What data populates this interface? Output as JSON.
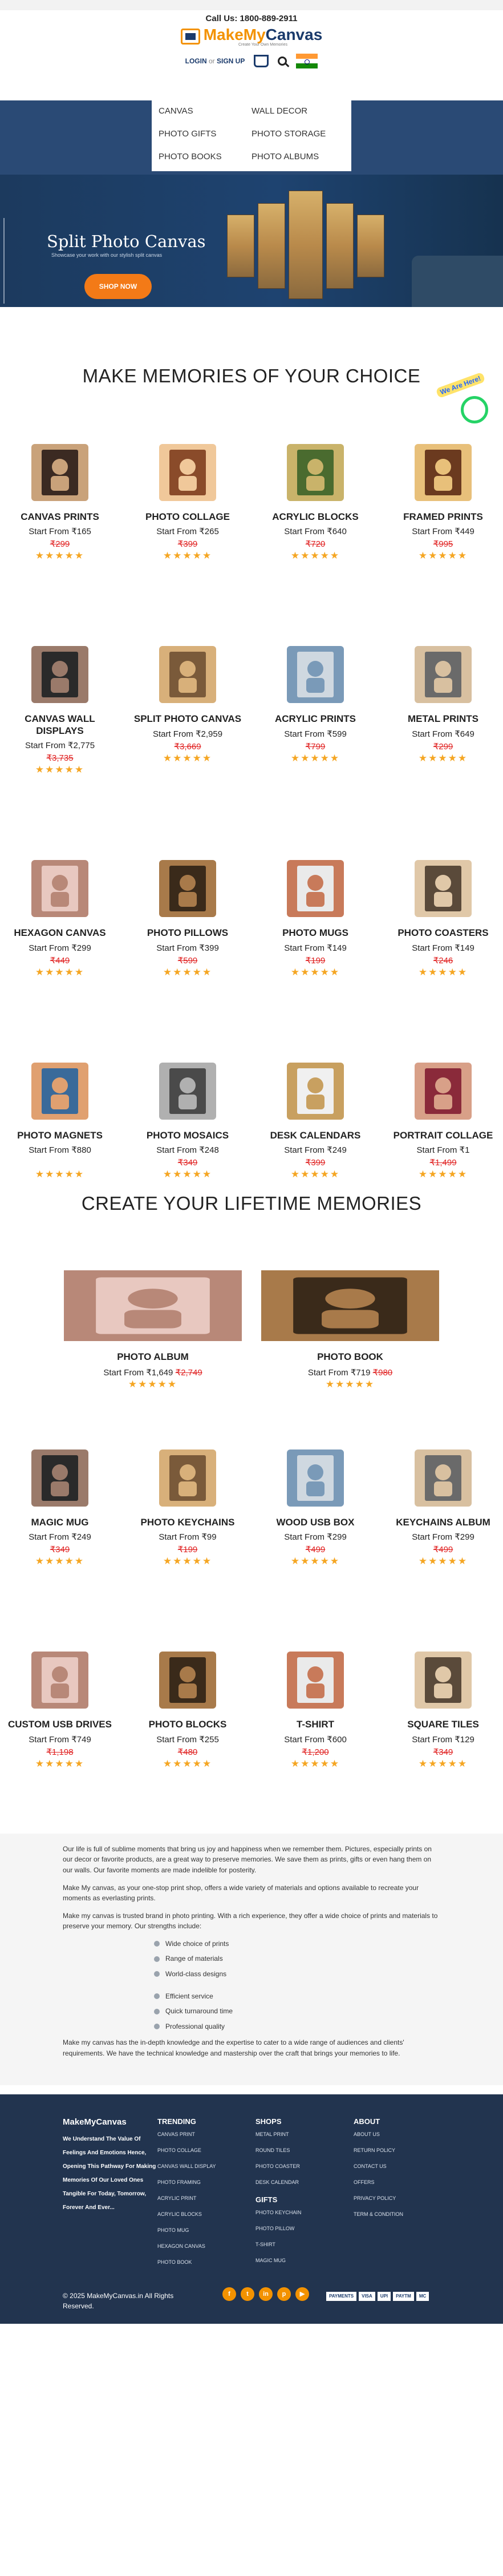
{
  "header": {
    "call_label": "Call Us:",
    "phone": "1800-889-2911",
    "logo_make": "MakeMy",
    "logo_canvas": "Canvas",
    "tagline": "Create Your Own Memories",
    "login": "LOGIN",
    "or": "or",
    "signup": "SIGN UP"
  },
  "nav": {
    "items": [
      "CANVAS",
      "WALL DECOR",
      "PHOTO GIFTS",
      "PHOTO STORAGE",
      "PHOTO BOOKS",
      "PHOTO ALBUMS"
    ]
  },
  "banner": {
    "title": "Split Photo Canvas",
    "subtitle": "Showcase your work with our stylish split canvas",
    "button": "SHOP NOW"
  },
  "chat_badge": "We Are Here!",
  "section1": {
    "title": "MAKE MEMORIES OF YOUR CHOICE",
    "products": [
      {
        "name": "CANVAS PRINTS",
        "price": "Start From ₹165",
        "old": "₹299"
      },
      {
        "name": "PHOTO COLLAGE",
        "price": "Start From ₹265",
        "old": "₹399"
      },
      {
        "name": "ACRYLIC BLOCKS",
        "price": "Start From ₹640",
        "old": "₹720"
      },
      {
        "name": "FRAMED PRINTS",
        "price": "Start From ₹449",
        "old": "₹995"
      },
      {
        "name": "CANVAS WALL DISPLAYS",
        "price": "Start From ₹2,775",
        "old": "₹3,735"
      },
      {
        "name": "SPLIT PHOTO CANVAS",
        "price": "Start From ₹2,959",
        "old": "₹3,669"
      },
      {
        "name": "ACRYLIC PRINTS",
        "price": "Start From ₹599",
        "old": "₹799"
      },
      {
        "name": "METAL PRINTS",
        "price": "Start From ₹649",
        "old": "₹299"
      },
      {
        "name": "HEXAGON CANVAS",
        "price": "Start From ₹299",
        "old": "₹449"
      },
      {
        "name": "PHOTO PILLOWS",
        "price": "Start From ₹399",
        "old": "₹599"
      },
      {
        "name": "PHOTO MUGS",
        "price": "Start From ₹149",
        "old": "₹199"
      },
      {
        "name": "PHOTO COASTERS",
        "price": "Start From ₹149",
        "old": "₹246"
      },
      {
        "name": "PHOTO MAGNETS",
        "price": "Start From ₹880",
        "old": ""
      },
      {
        "name": "PHOTO MOSAICS",
        "price": "Start From ₹248",
        "old": "₹349"
      },
      {
        "name": "DESK CALENDARS",
        "price": "Start From ₹249",
        "old": "₹399"
      },
      {
        "name": "PORTRAIT COLLAGE",
        "price": "Start From ₹1",
        "old": "₹1,499"
      }
    ]
  },
  "section2": {
    "title": "CREATE YOUR LIFETIME MEMORIES",
    "featured": [
      {
        "name": "PHOTO ALBUM",
        "price": "Start From ₹1,649",
        "old": "₹2,749"
      },
      {
        "name": "PHOTO BOOK",
        "price": "Start From ₹719",
        "old": "₹980"
      }
    ],
    "products": [
      {
        "name": "MAGIC MUG",
        "price": "Start From ₹249",
        "old": "₹349"
      },
      {
        "name": "PHOTO KEYCHAINS",
        "price": "Start From ₹99",
        "old": "₹199"
      },
      {
        "name": "WOOD USB BOX",
        "price": "Start From ₹299",
        "old": "₹499"
      },
      {
        "name": "KEYCHAINS ALBUM",
        "price": "Start From ₹299",
        "old": "₹499"
      },
      {
        "name": "CUSTOM USB DRIVES",
        "price": "Start From ₹749",
        "old": "₹1,198"
      },
      {
        "name": "PHOTO BLOCKS",
        "price": "Start From ₹255",
        "old": "₹480"
      },
      {
        "name": "T-SHIRT",
        "price": "Start From ₹600",
        "old": "₹1,200"
      },
      {
        "name": "SQUARE TILES",
        "price": "Start From ₹129",
        "old": "₹349"
      }
    ]
  },
  "stars": "★★★★★",
  "about": {
    "p1": "Our life is full of sublime moments that bring us joy and happiness when we remember them. Pictures, especially prints on our decor or favorite products, are a great way to preserve memories. We save them as prints, gifts or even hang them on our walls. Our favorite moments are made indelible for posterity.",
    "p2": "Make My canvas, as your one-stop print shop, offers a wide variety of materials and options available to recreate your moments as everlasting prints.",
    "p3": "Make my canvas is trusted brand in photo printing. With a rich experience, they offer a wide choice of prints and materials to preserve your memory. Our strengths include:",
    "list1": [
      "Wide choice of prints",
      "Range of materials",
      "World-class designs"
    ],
    "list2": [
      "Efficient service",
      "Quick turnaround time",
      "Professional quality"
    ],
    "p4": "Make my canvas has the in-depth knowledge and the expertise to cater to a wide range of audiences and clients' requirements. We have the technical knowledge and mastership over the craft that brings your memories to life."
  },
  "footer": {
    "logo": "MakeMyCanvas",
    "about_text": "We Understand The Value Of Feelings And Emotions Hence, Opening This Pathway For Making Memories Of Our Loved Ones Tangible For Today, Tomorrow, Forever And Ever...",
    "trending_head": "TRENDING",
    "trending": [
      "CANVAS PRINT",
      "PHOTO COLLAGE",
      "CANVAS WALL DISPLAY",
      "PHOTO FRAMING",
      "ACRYLIC PRINT",
      "ACRYLIC BLOCKS",
      "PHOTO MUG",
      "HEXAGON CANVAS",
      "PHOTO BOOK"
    ],
    "shops_head": "SHOPS",
    "shops": [
      "METAL PRINT",
      "ROUND TILES",
      "PHOTO COASTER",
      "DESK CALENDAR"
    ],
    "gifts_head": "GIFTS",
    "gifts": [
      "PHOTO KEYCHAIN",
      "PHOTO PILLOW",
      "T-SHIRT",
      "MAGIC MUG"
    ],
    "about_head": "ABOUT",
    "about_links": [
      "ABOUT US",
      "RETURN POLICY",
      "CONTACT US",
      "OFFERS",
      "PRIVACY POLICY",
      "TERM & CONDITION"
    ],
    "copyright": "© 2025 MakeMyCanvas.in All Rights Reserved.",
    "social": [
      "f",
      "t",
      "in",
      "p",
      "▶"
    ],
    "payments": [
      "PAYMENTS",
      "VISA",
      "UPI",
      "PAYTM",
      "MC"
    ]
  },
  "colors": {
    "accent": "#f39200",
    "navy": "#22344f",
    "price_old": "#e02020",
    "stars": "#f5a623"
  }
}
